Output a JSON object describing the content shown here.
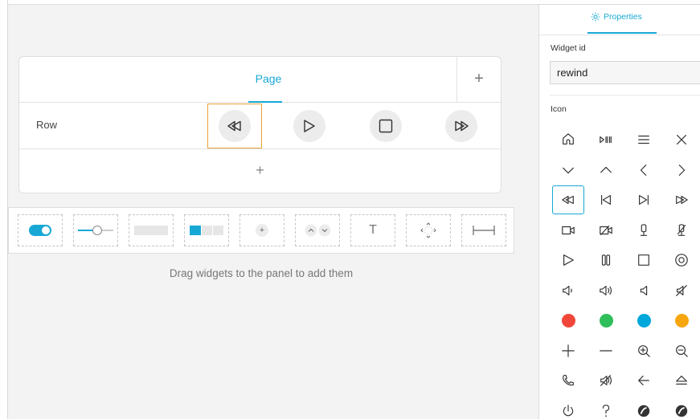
{
  "panel": {
    "page_tab": "Page",
    "add_page": "+",
    "row_label": "Row",
    "add_row": "+"
  },
  "row_buttons": [
    "rewind-icon",
    "play-icon",
    "stop-icon",
    "fast-forward-icon"
  ],
  "palette": {
    "items": [
      "toggle",
      "slider",
      "button",
      "group-button",
      "spinner",
      "direction-spinner",
      "text",
      "directional-pad",
      "spacer"
    ],
    "text_item_glyph": "T",
    "spinner_glyph": "+",
    "hint": "Drag widgets to the panel to add them"
  },
  "sidebar": {
    "tab_label": "Properties",
    "widget_id_label": "Widget id",
    "widget_id_value": "rewind",
    "icon_label": "Icon",
    "icons": [
      "home",
      "play-pause",
      "list",
      "close",
      "chevron-down",
      "chevron-up",
      "chevron-left",
      "chevron-right",
      "rewind",
      "previous",
      "next",
      "fast-forward",
      "camera",
      "camera-off",
      "mic",
      "mic-off",
      "play",
      "pause",
      "stop",
      "record",
      "volume-low",
      "volume-high",
      "volume-min",
      "mute",
      "red",
      "green",
      "blue",
      "orange",
      "plus",
      "minus",
      "zoom-in",
      "zoom-out",
      "phone",
      "speaker",
      "arrow-left",
      "eject",
      "power",
      "help",
      "blank",
      "blank-2"
    ],
    "selected_icon": "rewind"
  },
  "colors": {
    "accent": "#17a8d6",
    "selection": "#e9a23a",
    "red": "#f1473b",
    "green": "#2fbe5a",
    "blue": "#00a7da",
    "orange": "#f7a60d"
  }
}
